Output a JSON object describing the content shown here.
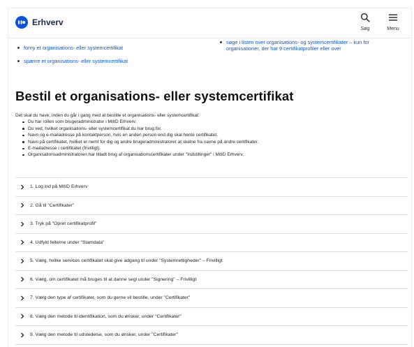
{
  "header": {
    "brand": "Erhverv",
    "search_label": "Søg",
    "menu_label": "Menu",
    "accent_color": "#0a52d6"
  },
  "links": {
    "left": [
      "forny et organisations- eller systemcertifikat",
      "spærre et organisations- eller systemcertifikat"
    ],
    "right": [
      "søge i listen over organisations- og systemcertifikater – kun for organisationer, der har 9 certifikatprofiler eller over"
    ]
  },
  "page": {
    "title": "Bestil et organisations- eller systemcertifikat",
    "intro": "Det skal du have, inden du går i gang med at bestille et organisations- eller systemcertifikat:",
    "requirements": [
      "Du har rollen som brugeradministrator i MitID Erhverv.",
      "Du ved, hvilket organisations- eller systemcertifikat du har brug for.",
      "Navn og e-mailadresse på kontaktperson, hvis en anden person end dig skal hente certifikatet.",
      "Navn på certifikatet, hvilket er nemt for dig og andre brugeradministratorer at skelne fra navne på andre certifikater.",
      "E-mailadresse i certifikatet (frivilligt).",
      "Organisationsadministratoren har tilladt brug af organisationscertifikater under \"Indstillinger\" i MitID Erhverv."
    ]
  },
  "steps": [
    "1. Log ind på MitID Erhverv",
    "2. Gå til \"Certifikater\"",
    "3. Tryk på \"Opret certifikatprofil\"",
    "4. Udfyld felterne under \"Stamdata\"",
    "5. Vælg, hvilke services certifikatet skal give adgang til under \"Systemrettigheder\" – Frivilligt",
    "6. Vælg, om certifikatet må bruges til at danne segl under \"Signering\" – Frivilligt",
    "7. Vælg den type af certifikater, som du gerne vil bestille, under \"Certifikater\"",
    "8. Vælg den metode til identifikation, som du ønsker, under \"Certifikater\"",
    "9. Vælg den metode til udstedelse, som du ønsker, under \"Certifikater\""
  ]
}
